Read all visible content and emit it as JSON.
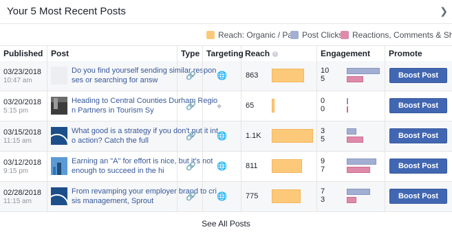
{
  "header": {
    "title": "Your 5 Most Recent Posts",
    "chevron_icon": "chevron-right-icon"
  },
  "legend": [
    {
      "label": "Reach: Organic / Paid",
      "color": "#fcc97a"
    },
    {
      "label": "Post Clicks",
      "color": "#a2afd3"
    },
    {
      "label": "Reactions, Comments & Shares",
      "color": "#e08aa9"
    }
  ],
  "columns": {
    "published": "Published",
    "post": "Post",
    "type": "Type",
    "targeting": "Targeting",
    "reach": "Reach",
    "engagement": "Engagement",
    "promote": "Promote"
  },
  "rows": [
    {
      "date": "03/23/2018",
      "time": "10:47 am",
      "text": "Do you find yourself sending similar responses or searching for answ",
      "type_icon": "link-icon",
      "targeting_icon": "globe-icon",
      "reach": "863",
      "reach_value": 863,
      "clicks": "10",
      "reactions": "5",
      "clicks_value": 10,
      "reactions_value": 5,
      "button": "Boost Post"
    },
    {
      "date": "03/20/2018",
      "time": "5:15 pm",
      "text": "Heading to Central Counties Durham Region Partners in Tourism Sy",
      "type_icon": "link-icon",
      "targeting_icon": "crosshair-icon",
      "reach": "65",
      "reach_value": 65,
      "clicks": "0",
      "reactions": "0",
      "clicks_value": 0,
      "reactions_value": 0,
      "button": "Boost Post"
    },
    {
      "date": "03/15/2018",
      "time": "11:15 am",
      "text": "What good is a strategy if you don't put it into action? Catch the full",
      "type_icon": "link-icon",
      "targeting_icon": "globe-icon",
      "reach": "1.1K",
      "reach_value": 1100,
      "clicks": "3",
      "reactions": "5",
      "clicks_value": 3,
      "reactions_value": 5,
      "button": "Boost Post"
    },
    {
      "date": "03/12/2018",
      "time": "9:15 pm",
      "text": "Earning an \"A\" for effort is nice, but it's not enough to succeed in the hi",
      "type_icon": "link-icon",
      "targeting_icon": "globe-icon",
      "reach": "811",
      "reach_value": 811,
      "clicks": "9",
      "reactions": "7",
      "clicks_value": 9,
      "reactions_value": 7,
      "button": "Boost Post"
    },
    {
      "date": "02/28/2018",
      "time": "11:15 am",
      "text": "From revamping your employer brand to crisis management, Sprout",
      "type_icon": "link-icon",
      "targeting_icon": "globe-icon",
      "reach": "775",
      "reach_value": 775,
      "clicks": "7",
      "reactions": "3",
      "clicks_value": 7,
      "reactions_value": 3,
      "button": "Boost Post"
    }
  ],
  "footer": {
    "see_all": "See All Posts"
  }
}
